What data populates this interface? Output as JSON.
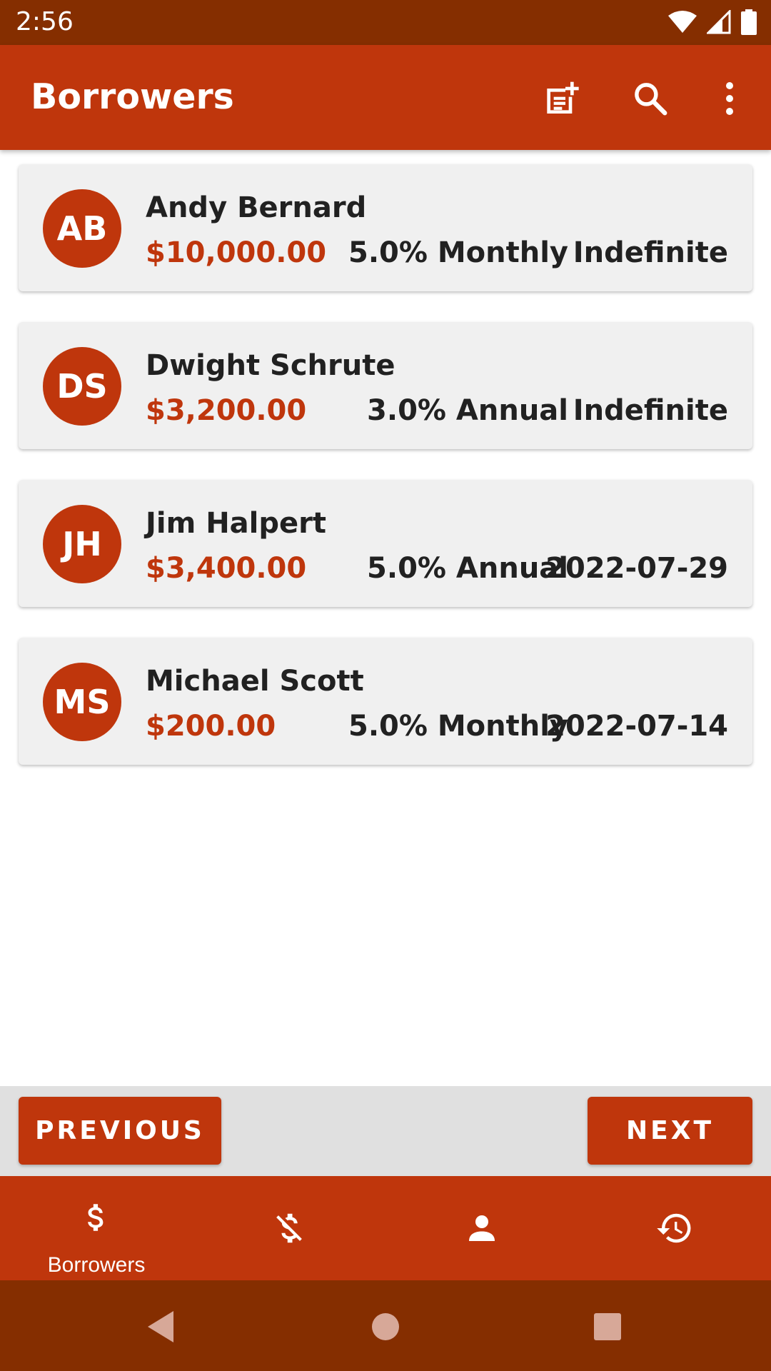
{
  "status_bar": {
    "time": "2:56",
    "icons": [
      "wifi-icon",
      "signal-icon",
      "battery-icon"
    ]
  },
  "app_bar": {
    "title": "Borrowers",
    "actions": [
      "note-add-icon",
      "search-icon",
      "more-vert-icon"
    ]
  },
  "borrowers": [
    {
      "initials": "AB",
      "name": "Andy Bernard",
      "amount": "$10,000.00",
      "rate": "5.0% Monthly",
      "due": "Indefinite"
    },
    {
      "initials": "DS",
      "name": "Dwight Schrute",
      "amount": "$3,200.00",
      "rate": "3.0% Annual",
      "due": "Indefinite"
    },
    {
      "initials": "JH",
      "name": "Jim Halpert",
      "amount": "$3,400.00",
      "rate": "5.0% Annual",
      "due": "2022-07-29"
    },
    {
      "initials": "MS",
      "name": "Michael Scott",
      "amount": "$200.00",
      "rate": "5.0% Monthly",
      "due": "2022-07-14"
    }
  ],
  "pager": {
    "previous_label": "PREVIOUS",
    "next_label": "NEXT"
  },
  "bottom_nav": {
    "items": [
      {
        "icon": "dollar-icon",
        "label": "Borrowers",
        "selected": true
      },
      {
        "icon": "money-off-icon",
        "label": "",
        "selected": false
      },
      {
        "icon": "person-icon",
        "label": "",
        "selected": false
      },
      {
        "icon": "history-icon",
        "label": "",
        "selected": false
      }
    ]
  },
  "colors": {
    "primary": "#bf360c",
    "primary_dark": "#852e00",
    "card_background": "#f0f0f0",
    "text_dark": "#212121"
  }
}
